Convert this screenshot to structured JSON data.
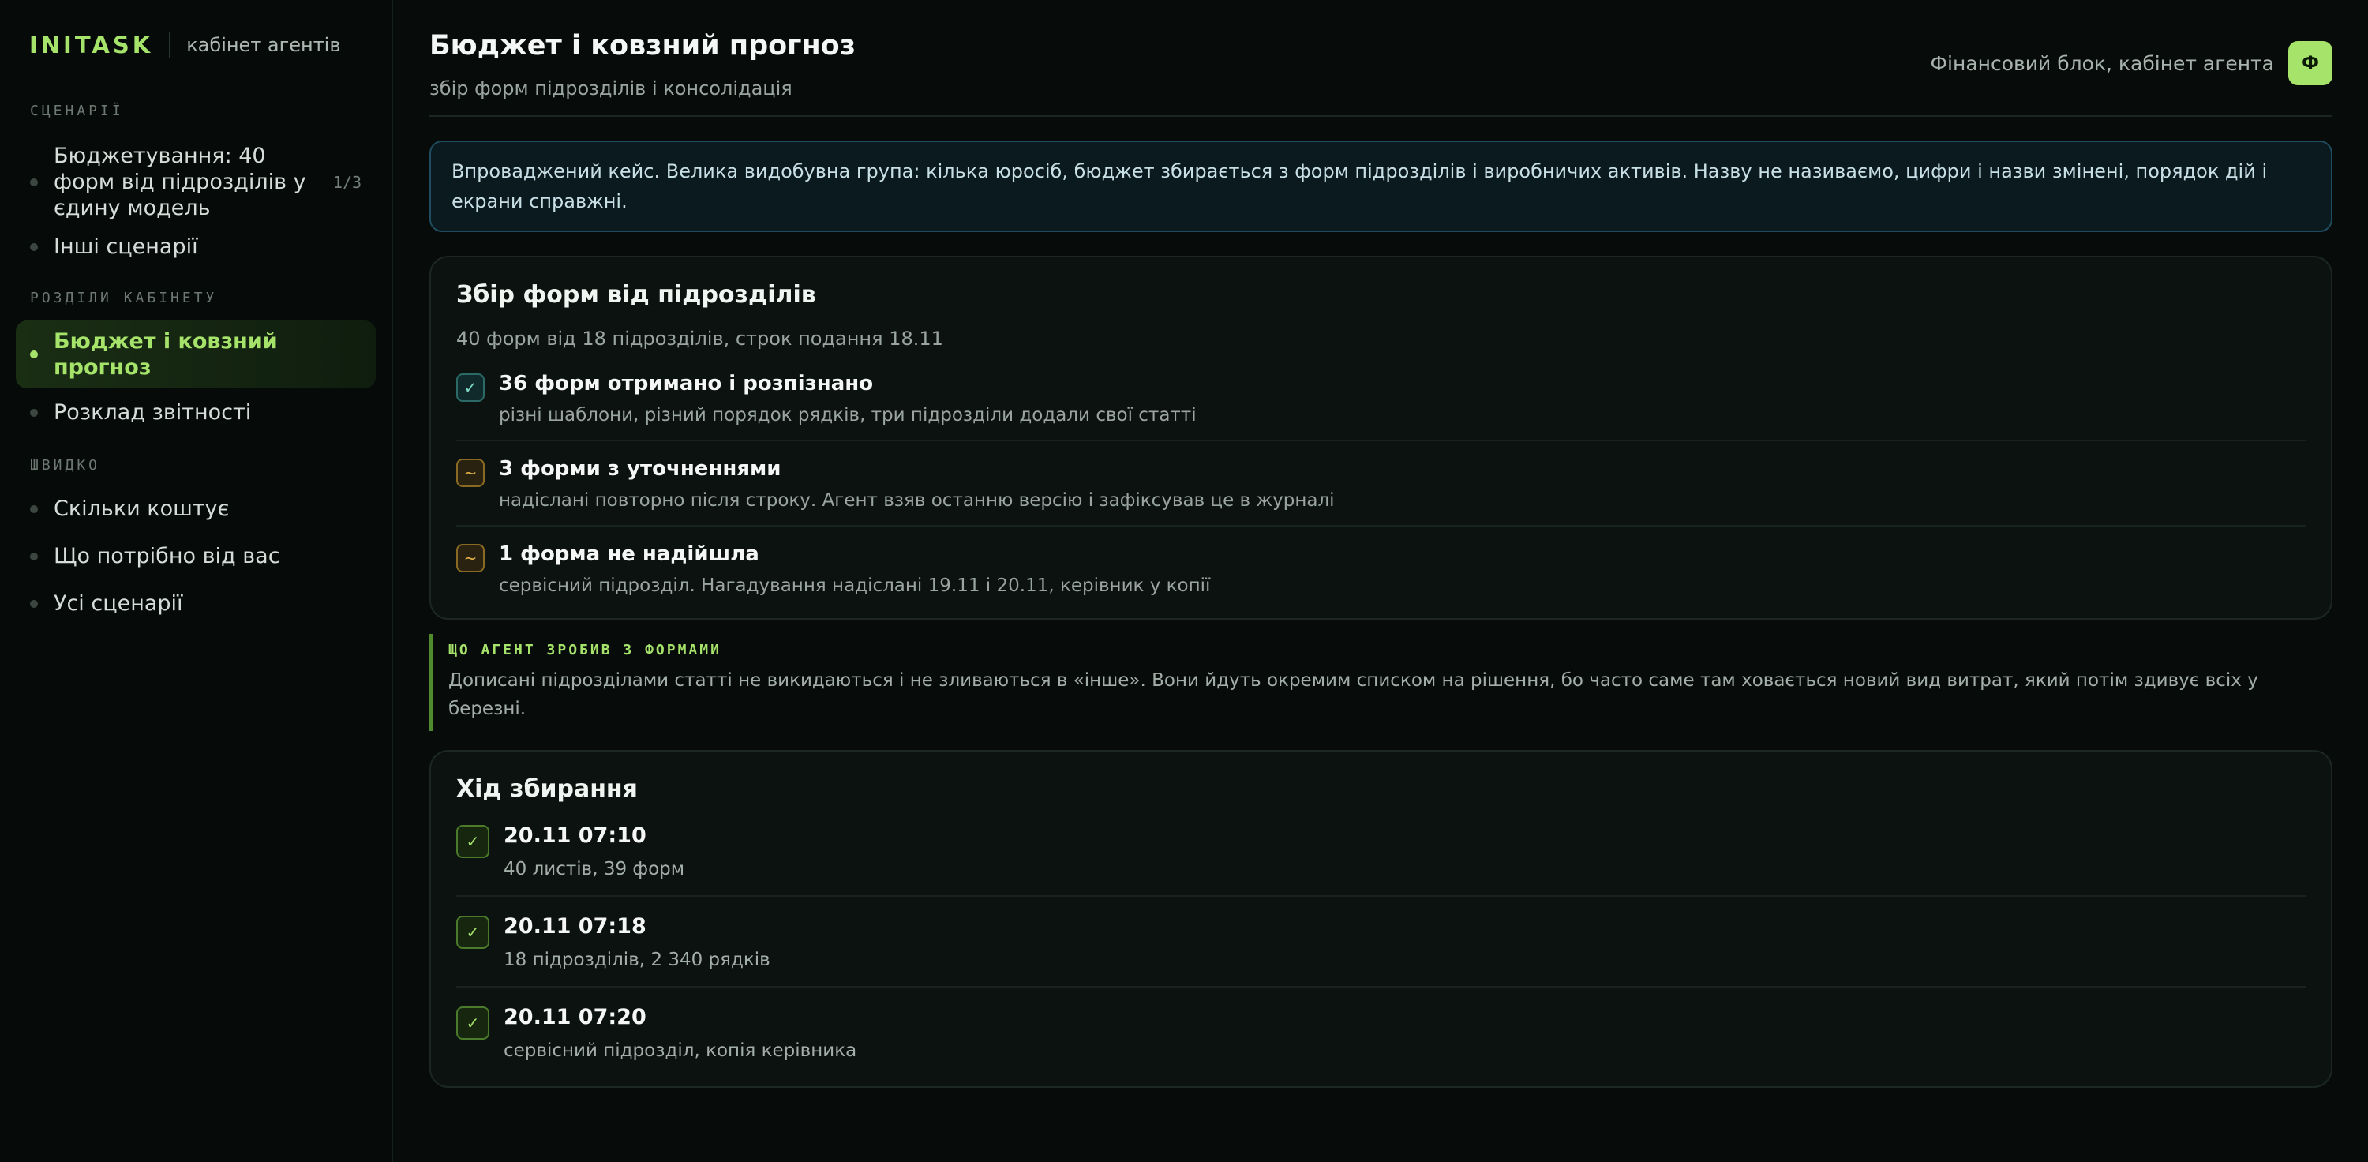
{
  "brand": {
    "logo": "INITASK",
    "subtitle": "кабінет агентів"
  },
  "sidebar": {
    "section_scenarios": "СЦЕНАРІЇ",
    "scenarios": [
      {
        "label": "Бюджетування: 40 форм від підрозділів у єдину модель",
        "count": "1/3"
      },
      {
        "label": "Інші сценарії"
      }
    ],
    "section_cabinet": "РОЗДІЛИ КАБІНЕТУ",
    "cabinet": [
      {
        "label": "Бюджет і ковзний прогноз",
        "active": true
      },
      {
        "label": "Розклад звітності"
      }
    ],
    "section_quick": "ШВИДКО",
    "quick": [
      {
        "label": "Скільки коштує"
      },
      {
        "label": "Що потрібно від вас"
      },
      {
        "label": "Усі сценарії"
      }
    ]
  },
  "header": {
    "title": "Бюджет і ковзний прогноз",
    "subtitle": "збір форм підрозділів і консолідація",
    "right_text": "Фінансовий блок, кабінет агента",
    "avatar": "Ф"
  },
  "notice": "Впроваджений кейс. Велика видобувна група: кілька юросіб, бюджет збирається з форм підрозділів і виробничих активів. Назву не називаємо, цифри і назви змінені, порядок дій і екрани справжні.",
  "forms_card": {
    "title": "Збір форм від підрозділів",
    "subtitle": "40 форм від 18 підрозділів, строк подання 18.11",
    "items": [
      {
        "status": "ok",
        "glyph": "✓",
        "title": "36 форм отримано і розпізнано",
        "sub": "різні шаблони, різний порядок рядків, три підрозділи додали свої статті"
      },
      {
        "status": "warn",
        "glyph": "~",
        "title": "3 форми з уточненнями",
        "sub": "надіслані повторно після строку. Агент взяв останню версію і зафіксував це в журналі"
      },
      {
        "status": "warn",
        "glyph": "~",
        "title": "1 форма не надійшла",
        "sub": "сервісний підрозділ. Нагадування надіслані 19.11 і 20.11, керівник у копії"
      }
    ]
  },
  "callout": {
    "label": "ЩО АГЕНТ ЗРОБИВ З ФОРМАМИ",
    "text": "Дописані підрозділами статті не викидаються і не зливаються в «інше». Вони йдуть окремим списком на рішення, бо часто саме там ховається новий вид витрат, який потім здивує всіх у березні."
  },
  "timeline_card": {
    "title": "Хід збирання",
    "items": [
      {
        "glyph": "✓",
        "time": "20.11 07:10",
        "sub": "40 листів, 39 форм"
      },
      {
        "glyph": "✓",
        "time": "20.11 07:18",
        "sub": "18 підрозділів, 2 340 рядків"
      },
      {
        "glyph": "✓",
        "time": "20.11 07:20",
        "sub": "сервісний підрозділ, копія керівника"
      }
    ]
  }
}
